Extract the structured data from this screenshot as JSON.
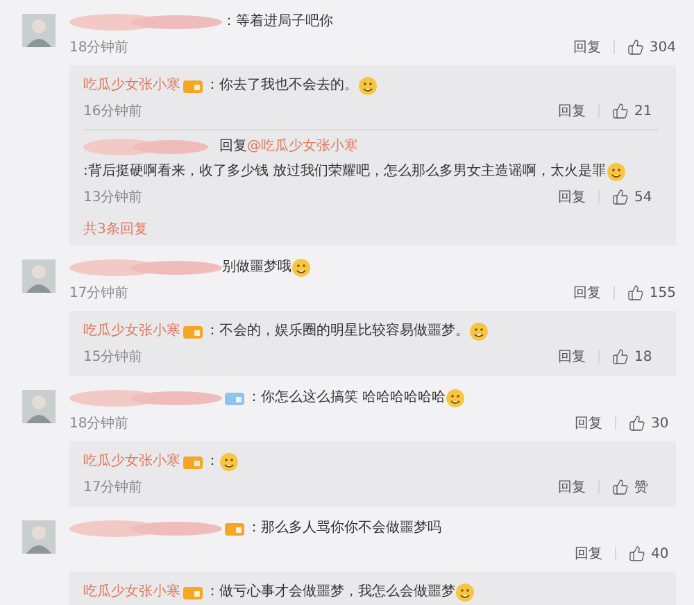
{
  "comments": [
    {
      "text": "：等着进局子吧你",
      "time": "18分钟前",
      "reply_label": "回复",
      "likes": "304",
      "replies": [
        {
          "author": "吃瓜少女张小寒",
          "author_hidden": false,
          "badge": {
            "color": "#f5a623"
          },
          "text": "：你去了我也不会去的。",
          "emoji": true,
          "time": "16分钟前",
          "reply_label": "回复",
          "likes": "21"
        },
        {
          "author_hidden": true,
          "reply_prefix": "回复",
          "reply_to": "@吃瓜少女张小寒",
          "text": ":背后挺硬啊看来，收了多少钱 放过我们荣耀吧，怎么那么多男女主造谣啊，太火是罪",
          "emoji": true,
          "time": "13分钟前",
          "reply_label": "回复",
          "likes": "54"
        }
      ],
      "more_replies": "共3条回复"
    },
    {
      "text": "别做噩梦哦",
      "emoji": true,
      "time": "17分钟前",
      "reply_label": "回复",
      "likes": "155",
      "replies": [
        {
          "author": "吃瓜少女张小寒",
          "author_hidden": false,
          "badge": {
            "color": "#f5a623"
          },
          "text": "：不会的，娱乐圈的明星比较容易做噩梦。",
          "emoji": true,
          "time": "15分钟前",
          "reply_label": "回复",
          "likes": "18"
        }
      ]
    },
    {
      "badge": {
        "color": "#8ec3ee"
      },
      "text": "：你怎么这么搞笑 哈哈哈哈哈哈",
      "emoji": true,
      "time": "18分钟前",
      "reply_label": "回复",
      "likes": "30",
      "replies": [
        {
          "author": "吃瓜少女张小寒",
          "author_hidden": false,
          "badge": {
            "color": "#f5a623"
          },
          "text": "：",
          "emoji": true,
          "time": "17分钟前",
          "reply_label": "回复",
          "likes": "赞"
        }
      ]
    },
    {
      "badge": {
        "color": "#f5a623"
      },
      "text": "：那么多人骂你你不会做噩梦吗",
      "reply_label": "回复",
      "likes": "40",
      "replies": [
        {
          "author": "吃瓜少女张小寒",
          "author_hidden": false,
          "badge": {
            "color": "#f5a623"
          },
          "text": "：做亏心事才会做噩梦，我怎么会做噩梦",
          "emoji": true
        }
      ]
    }
  ]
}
